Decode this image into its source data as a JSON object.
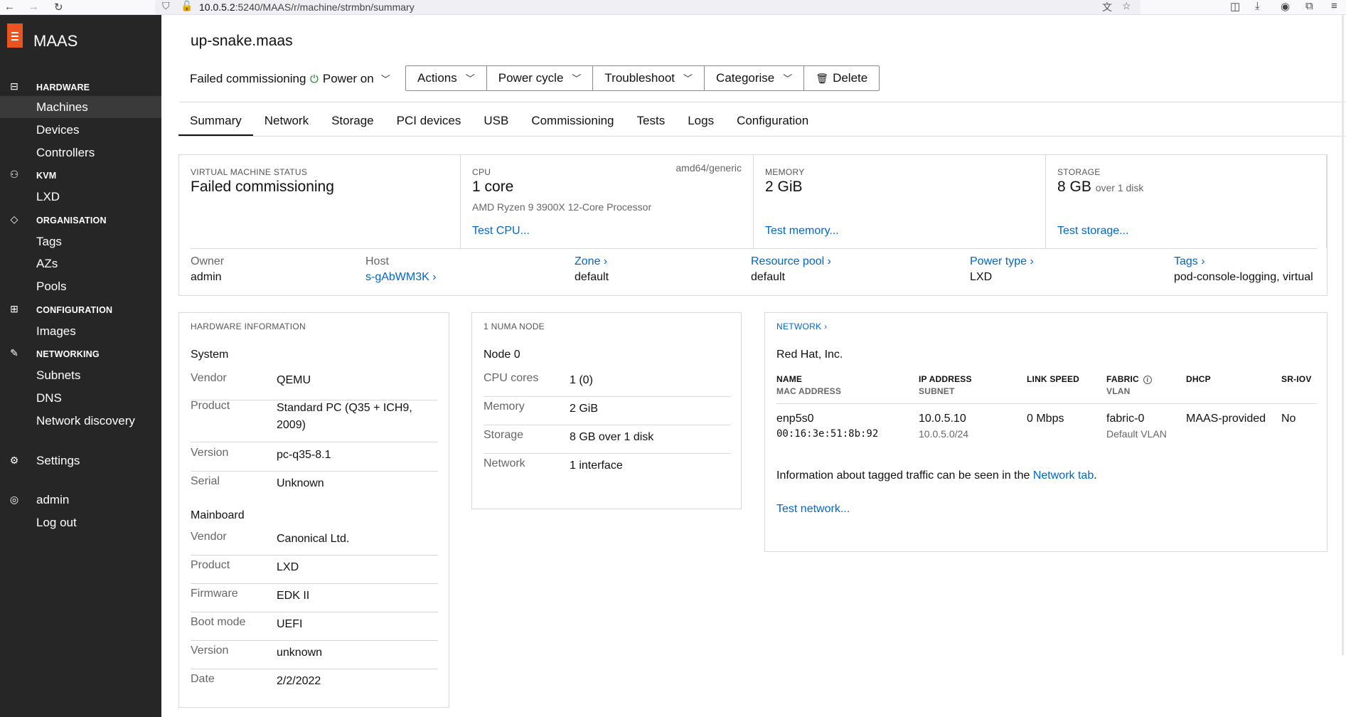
{
  "browser": {
    "url_host": "10.0.5.2",
    "url_rest": ":5240/MAAS/r/machine/strmbn/summary"
  },
  "sidebar": {
    "brand": "MAAS",
    "sections": {
      "hardware": "HARDWARE",
      "kvm": "KVM",
      "organisation": "ORGANISATION",
      "configuration": "CONFIGURATION",
      "networking": "NETWORKING"
    },
    "items": {
      "machines": "Machines",
      "devices": "Devices",
      "controllers": "Controllers",
      "lxd": "LXD",
      "tags": "Tags",
      "azs": "AZs",
      "pools": "Pools",
      "images": "Images",
      "subnets": "Subnets",
      "dns": "DNS",
      "network_discovery": "Network discovery",
      "settings": "Settings",
      "admin": "admin",
      "logout": "Log out"
    }
  },
  "header": {
    "title": "up-snake.maas",
    "status": "Failed commissioning",
    "power": "Power on",
    "actions": [
      "Actions",
      "Power cycle",
      "Troubleshoot",
      "Categorise"
    ],
    "delete": "Delete"
  },
  "tabs": [
    "Summary",
    "Network",
    "Storage",
    "PCI devices",
    "USB",
    "Commissioning",
    "Tests",
    "Logs",
    "Configuration"
  ],
  "overview": {
    "status": {
      "label": "VIRTUAL MACHINE STATUS",
      "value": "Failed commissioning"
    },
    "cpu": {
      "label": "CPU",
      "value": "1 core",
      "arch": "amd64/generic",
      "model": "AMD Ryzen 9 3900X 12-Core Processor",
      "test": "Test CPU..."
    },
    "memory": {
      "label": "MEMORY",
      "value": "2 GiB",
      "test": "Test memory..."
    },
    "storage": {
      "label": "STORAGE",
      "value": "8 GB",
      "sub": "over 1 disk",
      "test": "Test storage..."
    },
    "meta": {
      "owner_label": "Owner",
      "owner": "admin",
      "host_label": "Host",
      "host": "s-gAbWM3K ›",
      "zone_label": "Zone ›",
      "zone": "default",
      "pool_label": "Resource pool ›",
      "pool": "default",
      "power_label": "Power type ›",
      "power": "LXD",
      "tags_label": "Tags ›",
      "tags": "pod-console-logging, virtual"
    }
  },
  "hardware": {
    "title": "HARDWARE INFORMATION",
    "system_head": "System",
    "system": [
      {
        "k": "Vendor",
        "v": "QEMU"
      },
      {
        "k": "Product",
        "v": "Standard PC (Q35 + ICH9, 2009)"
      },
      {
        "k": "Version",
        "v": "pc-q35-8.1"
      },
      {
        "k": "Serial",
        "v": "Unknown"
      }
    ],
    "mainboard_head": "Mainboard",
    "mainboard": [
      {
        "k": "Vendor",
        "v": "Canonical Ltd."
      },
      {
        "k": "Product",
        "v": "LXD"
      },
      {
        "k": "Firmware",
        "v": "EDK II"
      },
      {
        "k": "Boot mode",
        "v": "UEFI"
      },
      {
        "k": "Version",
        "v": "unknown"
      },
      {
        "k": "Date",
        "v": "2/2/2022"
      }
    ]
  },
  "numa": {
    "title": "1 NUMA NODE",
    "node": "Node 0",
    "rows": [
      {
        "k": "CPU cores",
        "v": "1 (0)"
      },
      {
        "k": "Memory",
        "v": "2 GiB"
      },
      {
        "k": "Storage",
        "v": "8 GB over 1 disk"
      },
      {
        "k": "Network",
        "v": "1 interface"
      }
    ]
  },
  "network": {
    "title": "NETWORK ›",
    "vendor": "Red Hat, Inc.",
    "headers": {
      "name": "NAME",
      "mac": "MAC ADDRESS",
      "ip": "IP ADDRESS",
      "subnet": "SUBNET",
      "speed": "LINK SPEED",
      "fabric": "FABRIC",
      "vlan": "VLAN",
      "dhcp": "DHCP",
      "sriov": "SR-IOV"
    },
    "row": {
      "name": "enp5s0",
      "mac": "00:16:3e:51:8b:92",
      "ip": "10.0.5.10",
      "subnet": "10.0.5.0/24",
      "speed": "0 Mbps",
      "fabric": "fabric-0",
      "vlan": "Default VLAN",
      "dhcp": "MAAS-provided",
      "sriov": "No"
    },
    "info_text": "Information about tagged traffic can be seen in the",
    "info_link": "Network tab",
    "info_end": ".",
    "test": "Test network..."
  }
}
